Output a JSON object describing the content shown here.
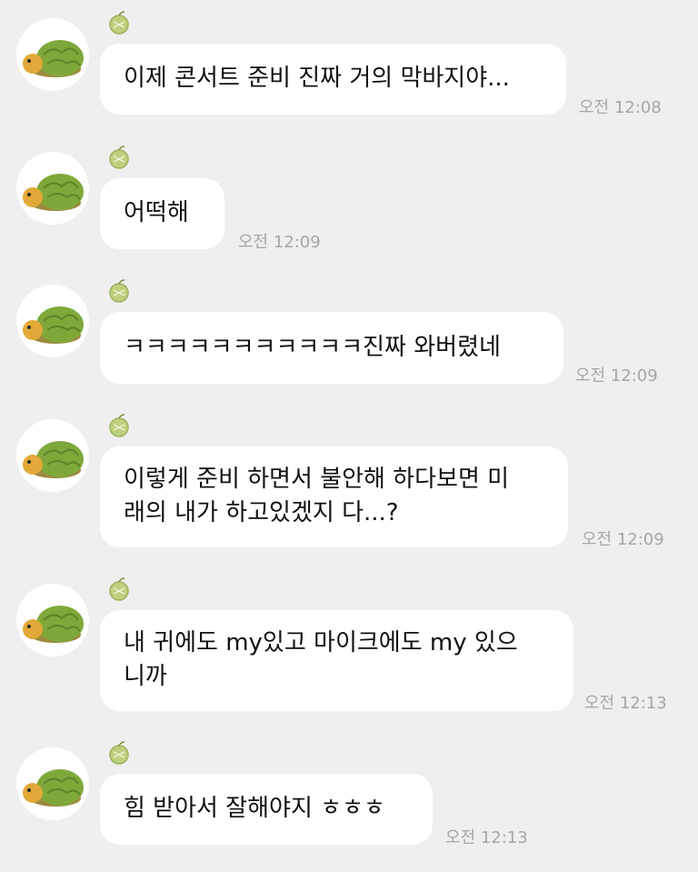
{
  "messages": [
    {
      "lines": [
        "이제 콘서트 준비 진짜 거의 막바지야..."
      ],
      "time": "오전 12:08"
    },
    {
      "lines": [
        "어떡해"
      ],
      "time": "오전 12:09"
    },
    {
      "lines": [
        "ㅋㅋㅋㅋㅋㅋㅋㅋㅋㅋㅋ진짜 와버렸네"
      ],
      "time": "오전 12:09"
    },
    {
      "lines": [
        "이렇게 준비 하면서 불안해 하다보면 미",
        "래의 내가 하고있겠지 다...?"
      ],
      "time": "오전 12:09"
    },
    {
      "lines": [
        "내 귀에도 my있고 마이크에도 my 있으",
        "니까"
      ],
      "time": "오전 12:13"
    },
    {
      "lines": [
        "힘 받아서 잘해야지 ㅎㅎㅎ"
      ],
      "time": "오전 12:13"
    }
  ],
  "icons": {
    "avatar": "turtle-avatar",
    "sender_badge": "melon-icon"
  },
  "colors": {
    "background": "#efeff0",
    "bubble": "#ffffff",
    "timestamp": "#a6a6a6"
  }
}
